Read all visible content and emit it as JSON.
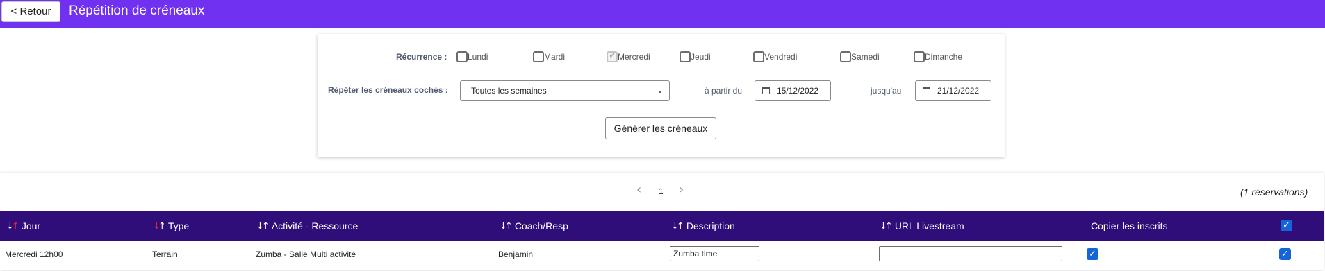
{
  "header": {
    "back_label": "< Retour",
    "title": "Répétition de créneaux"
  },
  "recurrence": {
    "label": "Récurrence :",
    "days": [
      {
        "label": "Lundi",
        "checked": false,
        "disabled": false
      },
      {
        "label": "Mardi",
        "checked": false,
        "disabled": false
      },
      {
        "label": "Mercredi",
        "checked": true,
        "disabled": true
      },
      {
        "label": "Jeudi",
        "checked": false,
        "disabled": false
      },
      {
        "label": "Vendredi",
        "checked": false,
        "disabled": false
      },
      {
        "label": "Samedi",
        "checked": false,
        "disabled": false
      },
      {
        "label": "Dimanche",
        "checked": false,
        "disabled": false
      }
    ]
  },
  "repeat": {
    "label": "Répéter les créneaux cochés :",
    "frequency_value": "Toutes les semaines",
    "from_label": "à partir du",
    "from_date": "15/12/2022",
    "until_label": "jusqu'au",
    "until_date": "21/12/2022",
    "generate_label": "Générer les créneaux"
  },
  "pagination": {
    "prev_icon": "‹",
    "current_page": "1",
    "next_icon": "›",
    "reservations_count": "(1 réservations)"
  },
  "table": {
    "columns": [
      {
        "label": "Jour",
        "sort_active": "up"
      },
      {
        "label": "Type",
        "sort_active": "down"
      },
      {
        "label": "Activité - Ressource",
        "sort_active": "none"
      },
      {
        "label": "Coach/Resp",
        "sort_active": "none"
      },
      {
        "label": "Description",
        "sort_active": "none"
      },
      {
        "label": "URL Livestream",
        "sort_active": "none"
      },
      {
        "label": "Copier les inscrits",
        "sort_active": "none"
      }
    ],
    "select_all_checked": true,
    "rows": [
      {
        "jour": "Mercredi 12h00",
        "type": "Terrain",
        "activite": "Zumba - Salle Multi activité",
        "coach": "Benjamin",
        "description": "Zumba time",
        "url_livestream": "",
        "copier_inscrits": true,
        "selected": true
      }
    ]
  },
  "colors": {
    "header_bg": "#7032f0",
    "table_header_bg": "#300e7a",
    "checkbox_blue": "#1565d8",
    "sort_active_red": "#e6213c"
  }
}
